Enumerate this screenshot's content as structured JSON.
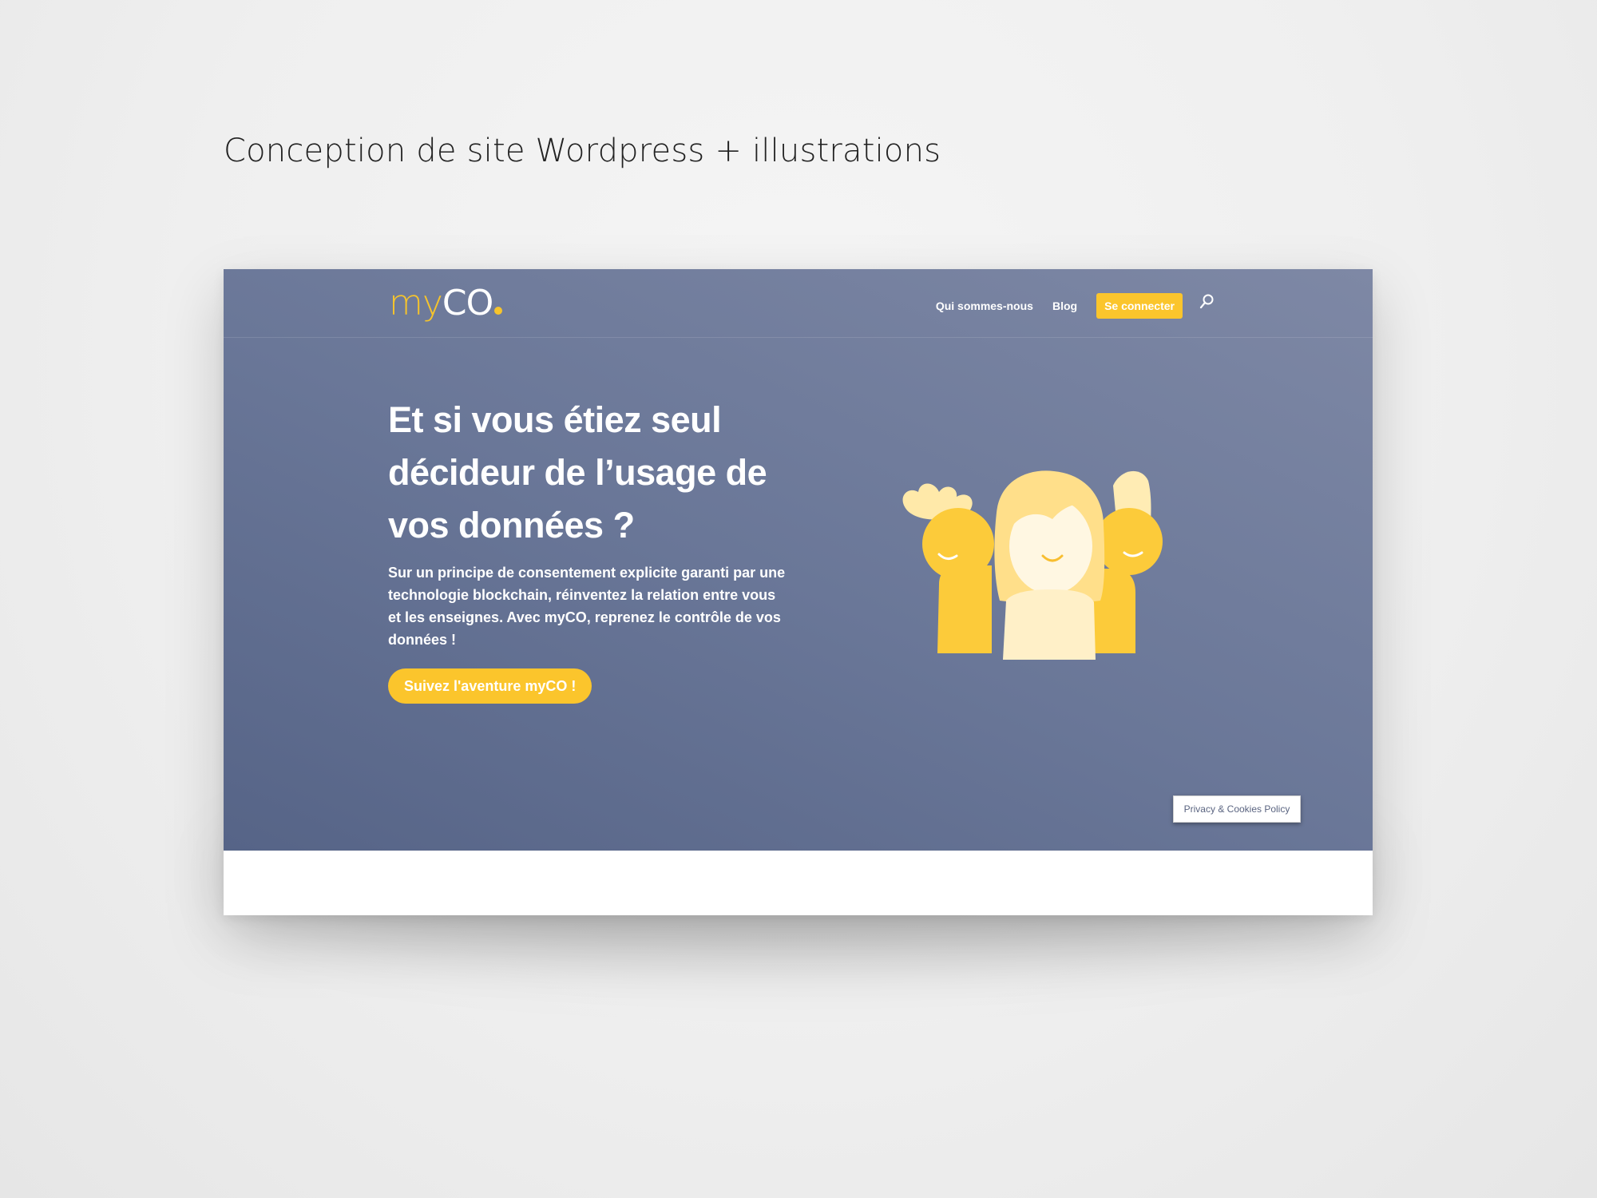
{
  "caption": "Conception de site Wordpress + illustrations",
  "site": {
    "logo": {
      "part1": "my",
      "part2": "CO"
    },
    "nav": {
      "items": [
        {
          "label": "Qui sommes-nous"
        },
        {
          "label": "Blog"
        }
      ],
      "cta": "Se connecter",
      "search_icon": "search-icon"
    },
    "hero": {
      "headline": "Et si vous étiez seul décideur de l’usage de vos données ?",
      "description": "Sur un principe de consentement explicite garanti par une technologie blockchain, réinventez la relation entre vous et les enseignes. Avec myCO, reprenez le contrôle de vos données !",
      "cta": "Suivez l'aventure myCO !",
      "illustration": "group-of-people-illustration"
    },
    "privacy_badge": "Privacy & Cookies Policy"
  },
  "colors": {
    "hero_bg_start": "#566487",
    "hero_bg_end": "#7e88a5",
    "accent_yellow": "#fbc52c",
    "light_yellow": "#ffecb4",
    "pale_yellow": "#fff3d0",
    "text_white": "#ffffff"
  }
}
